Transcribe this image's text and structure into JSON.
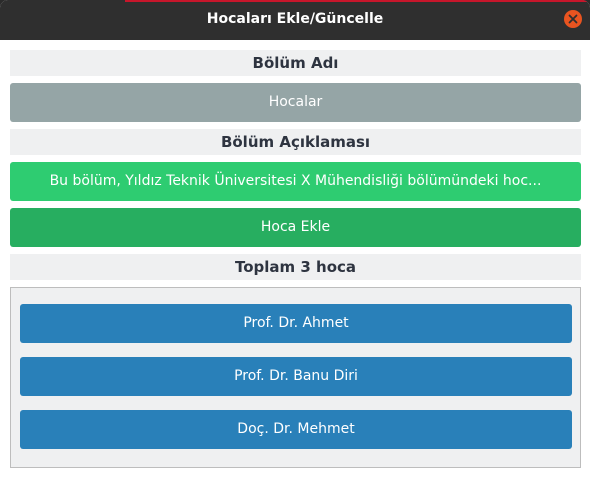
{
  "window": {
    "title": "Hocaları Ekle/Güncelle"
  },
  "form": {
    "name_label": "Bölüm Adı",
    "name_value": "Hocalar",
    "description_label": "Bölüm Açıklaması",
    "description_value": "Bu bölüm, Yıldız Teknik Üniversitesi X Mühendisliği bölümündeki hoc...",
    "add_button_label": "Hoca Ekle",
    "total_label": "Toplam 3 hoca"
  },
  "teachers": [
    {
      "name": "Prof. Dr. Ahmet"
    },
    {
      "name": "Prof. Dr. Banu Diri"
    },
    {
      "name": "Doç. Dr. Mehmet"
    }
  ],
  "colors": {
    "titlebar": "#2f2f2f",
    "close_button": "#e95420",
    "name_field": "#95a5a6",
    "description_field": "#2ecc71",
    "add_button": "#27ae60",
    "teacher_item": "#2980b9"
  },
  "icons": {
    "close": "close-icon"
  }
}
